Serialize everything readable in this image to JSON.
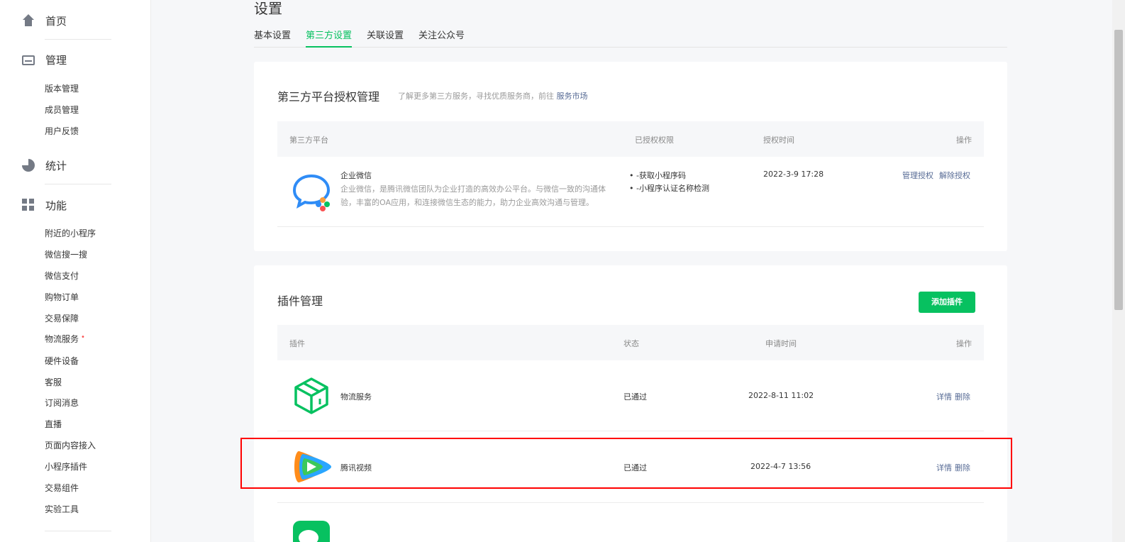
{
  "sidebar": {
    "home": "首页",
    "manage": {
      "label": "管理",
      "items": [
        "版本管理",
        "成员管理",
        "用户反馈"
      ]
    },
    "stats": "统计",
    "features": {
      "label": "功能",
      "items": [
        "附近的小程序",
        "微信搜一搜",
        "微信支付",
        "购物订单",
        "交易保障",
        "物流服务",
        "硬件设备",
        "客服",
        "订阅消息",
        "直播",
        "页面内容接入",
        "小程序插件",
        "交易组件",
        "实验工具"
      ],
      "badge_marker": "•"
    }
  },
  "page": {
    "title": "设置",
    "tabs": [
      "基本设置",
      "第三方设置",
      "关联设置",
      "关注公众号"
    ],
    "active_tab": "第三方设置"
  },
  "third_party": {
    "title": "第三方平台授权管理",
    "desc": "了解更多第三方服务，寻找优质服务商，前往",
    "market_link": "服务市场",
    "columns": [
      "第三方平台",
      "已授权权限",
      "授权时间",
      "操作"
    ],
    "rows": [
      {
        "name": "企业微信",
        "desc_line1": "企业微信，是腾讯微信团队为企业打造的高效办公平台。与微信一致的沟通体",
        "desc_line2": "验，丰富的OA应用，和连接微信生态的能力，助力企业高效沟通与管理。",
        "perm1": "• -获取小程序码",
        "perm2": "• -小程序认证名称检测",
        "time": "2022-3-9 17:28",
        "action1": "管理授权",
        "action2": "解除授权"
      }
    ]
  },
  "plugins": {
    "title": "插件管理",
    "add_button": "添加插件",
    "columns": [
      "插件",
      "状态",
      "申请时间",
      "操作"
    ],
    "rows": [
      {
        "name": "物流服务",
        "status": "已通过",
        "time": "2022-8-11 11:02",
        "action1": "详情",
        "action2": "删除"
      },
      {
        "name": "腾讯视频",
        "status": "已通过",
        "time": "2022-4-7 13:56",
        "action1": "详情",
        "action2": "删除"
      }
    ]
  },
  "colors": {
    "accent": "#07c160",
    "link": "#576b95",
    "highlight": "#ff0000"
  }
}
